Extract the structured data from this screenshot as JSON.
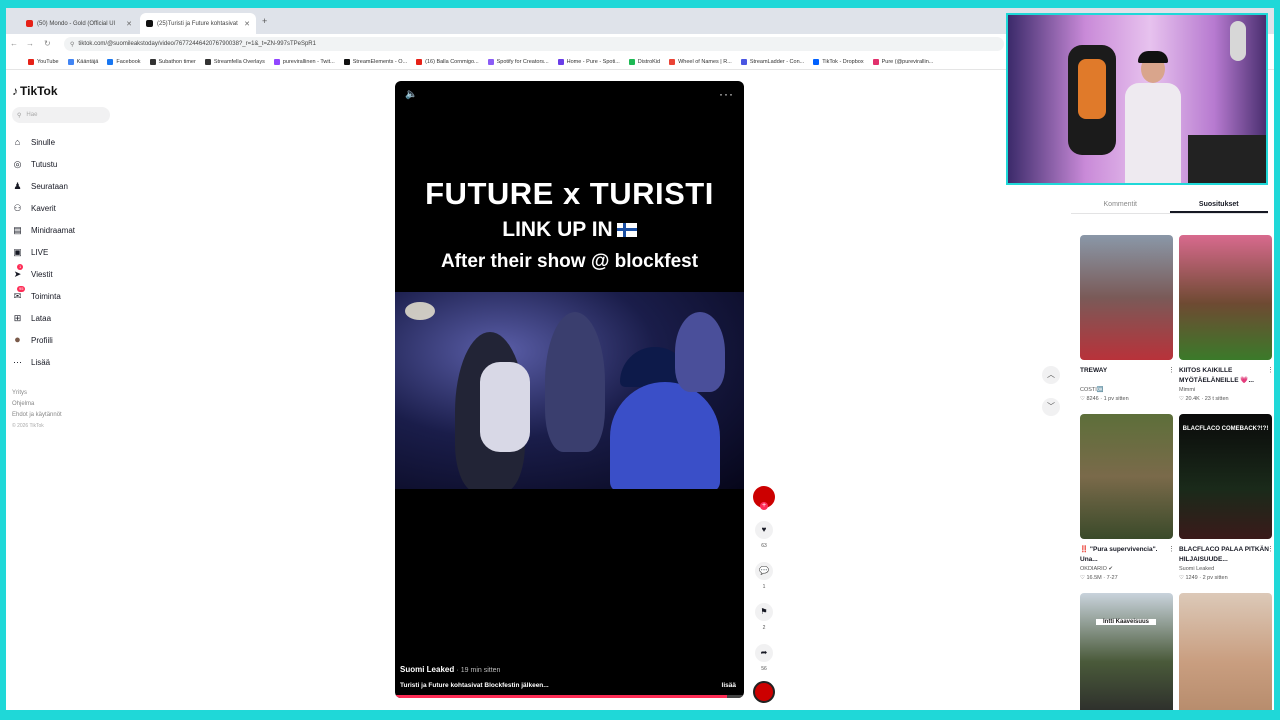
{
  "browser": {
    "tabs": [
      {
        "label": "(50) Mondo - Gold (Official Ul",
        "color": "#e62117"
      },
      {
        "label": "(25)Turisti ja Future kohtasivat",
        "color": "#111111"
      }
    ],
    "new_tab_label": "+",
    "url": "tiktok.com/@suomileakstoday/video/7677244642076790038?_r=1&_t=ZN-997sTPeSpR1",
    "bookmarks": [
      {
        "label": "YouTube",
        "color": "#e62117"
      },
      {
        "label": "Kääntäjä",
        "color": "#4285f4"
      },
      {
        "label": "Facebook",
        "color": "#1877f2"
      },
      {
        "label": "Subathon timer",
        "color": "#333333"
      },
      {
        "label": "Streamfella Overlays",
        "color": "#333333"
      },
      {
        "label": "purevirallinen - Twit...",
        "color": "#9146ff"
      },
      {
        "label": "StreamElements - O...",
        "color": "#111111"
      },
      {
        "label": "(16) Balla Cornmigo...",
        "color": "#e62117"
      },
      {
        "label": "Spotify for Creators...",
        "color": "#8b5cf6"
      },
      {
        "label": "Home - Pure - Spoti...",
        "color": "#6a3de8"
      },
      {
        "label": "DistroKid",
        "color": "#1db954"
      },
      {
        "label": "Wheel of Names | R...",
        "color": "#ea4335"
      },
      {
        "label": "StreamLadder - Con...",
        "color": "#4a56e2"
      },
      {
        "label": "TikTok - Dropbox",
        "color": "#0061ff"
      },
      {
        "label": "Pure (@purevirallin...",
        "color": "#e1306c"
      }
    ]
  },
  "sidebar": {
    "logo": "TikTok",
    "search_placeholder": "Hae",
    "items": [
      {
        "label": "Sinulle",
        "icon": "home-icon",
        "glyph": "⌂"
      },
      {
        "label": "Tutustu",
        "icon": "compass-icon",
        "glyph": "◎"
      },
      {
        "label": "Seurataan",
        "icon": "following-icon",
        "glyph": "♟"
      },
      {
        "label": "Kaverit",
        "icon": "friends-icon",
        "glyph": "⚇"
      },
      {
        "label": "Minidraamat",
        "icon": "minidrama-icon",
        "glyph": "▤"
      },
      {
        "label": "LIVE",
        "icon": "live-icon",
        "glyph": "▣"
      },
      {
        "label": "Viestit",
        "icon": "messages-icon",
        "glyph": "➤",
        "badge": "1"
      },
      {
        "label": "Toiminta",
        "icon": "activity-icon",
        "glyph": "✉",
        "badge": "95"
      },
      {
        "label": "Lataa",
        "icon": "upload-icon",
        "glyph": "⊞"
      },
      {
        "label": "Profiili",
        "icon": "profile-avatar",
        "glyph": "●"
      },
      {
        "label": "Lisää",
        "icon": "more-icon",
        "glyph": "⋯"
      }
    ],
    "footer": [
      "Yritys",
      "Ohjelma",
      "Ehdot ja käytännöt"
    ],
    "copyright": "© 2026 TikTok"
  },
  "video": {
    "title_line1": "FUTURE x TURISTI",
    "title_line2": "LINK UP IN",
    "title_line3": "After their show @ blockfest",
    "author": "Suomi Leaked",
    "time": "· 19 min sitten",
    "caption": "Turisti ja Future kohtasivat Blockfestin jälkeen...",
    "more_link": "lisää",
    "progress": 0.95
  },
  "actions": {
    "likes": "63",
    "comments": "1",
    "saves": "2",
    "shares": "56"
  },
  "right_panel": {
    "tabs": [
      "Kommentit",
      "Suositukset"
    ],
    "active_tab": "Suositukset",
    "cards": [
      {
        "title": "TREWAY",
        "author": "COSTI🆗",
        "meta": "♡ 8246 · 1 pv sitten",
        "overlay": "",
        "bg": "linear-gradient(180deg,#8a98a8 0%,#7a5a58 50%,#b8323a 100%)"
      },
      {
        "title": "KIITOS KAIKILLE MYÖTÄELÄNEILLE 💗...",
        "author": "Mimmi",
        "meta": "♡ 20.4K · 23 t sitten",
        "overlay": "",
        "bg": "linear-gradient(180deg,#d86a8e 0%,#6e4a32 55%,#3b7a2a 100%)"
      },
      {
        "title": "‼️ \"Pura supervivencia\". Una...",
        "author": "OKDIARIO ✔",
        "meta": "♡ 16.5M · 7-27",
        "overlay": "",
        "bg": "linear-gradient(180deg,#5d6f3a 0%,#7a6a4a 50%,#3a4a2a 100%)"
      },
      {
        "title": "BLACFLACO PALAA PITKÄN HILJAISUUDE...",
        "author": "Suomi Leaked",
        "meta": "♡ 1249 · 2 pv sitten",
        "overlay": "BLACFLACO COMEBACK?!?!",
        "bg": "linear-gradient(180deg,#0a0a0a 0%,#1a2a1a 60%,#3a1a1a 100%)"
      },
      {
        "title": "",
        "author": "",
        "meta": "",
        "overlay": "Intti Kaaveisuus",
        "bg": "linear-gradient(180deg,#c9d3dc 0%,#4a5a3a 55%,#2a2a2a 100%)"
      },
      {
        "title": "",
        "author": "",
        "meta": "",
        "overlay": "",
        "bg": "linear-gradient(180deg,#dcc9b8 0%,#c99e80 55%,#b58a6a 100%)"
      }
    ]
  },
  "colors": {
    "accent": "#fe2c55",
    "frame": "#1fd8d8"
  }
}
